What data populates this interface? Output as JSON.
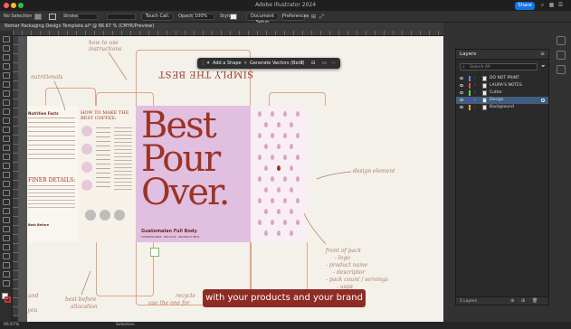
{
  "titlebar": {
    "app_title": "Adobe Illustrator 2024",
    "share_label": "Share"
  },
  "controlbar": {
    "selection_label": "No Selection",
    "stroke_label": "Stroke:",
    "brush_label": "Touch Call.",
    "opacity_label": "Opacity:",
    "opacity_value": "100%",
    "style_label": "Style:",
    "document_setup": "Document Setup",
    "preferences": "Preferences"
  },
  "doc_tab": {
    "label": "Nomer Packaging Design Template.ai* @ 66.67 % (CMYK/Preview)"
  },
  "context_bar": {
    "add_shape": "Add a Shape",
    "generate_vectors": "Generate Vectors (Beta)"
  },
  "artboard": {
    "top_flap_text": "SIMPLY THE BEST",
    "front_title_lines": [
      "Best",
      "Pour",
      "Over."
    ],
    "front_subtitle": "Guatemalan   Full Body",
    "front_tiny": "COMPOSTABLE · RECYCLE · PRODUCT INFO",
    "side_heading": "HOW TO MAKE THE BEST COFFEE:",
    "left_heading": "Nutrition Facts",
    "left_finer": "FINER DETAILS:",
    "left_best_before": "Best Before"
  },
  "annotations": {
    "how_to_use": "how to use\ninstructions",
    "nutritionals": "nutritionals",
    "design_element": "design element",
    "front_of_pack": "front of pack",
    "logo": "- logo",
    "product_name": "- product name",
    "descriptor": "- descriptor",
    "pack_count": "- pack count / servings",
    "usps": "- usps",
    "recycle": "recycle",
    "use_the_one": "use the one for",
    "best_before": "best before",
    "allocation": "allocation",
    "nts_and": "nts and",
    "or_you": "or you"
  },
  "caption": "with your products and your brand",
  "layers_panel": {
    "title": "Layers",
    "search_placeholder": "Search All",
    "layers": [
      {
        "name": "DO NOT PRINT",
        "color": "#4a90e2",
        "selected": false
      },
      {
        "name": "LAURA'S NOTES",
        "color": "#e24a4a",
        "selected": false
      },
      {
        "name": "Cutter",
        "color": "#4ae24a",
        "selected": false
      },
      {
        "name": "Design",
        "color": "#4a4ae2",
        "selected": true
      },
      {
        "name": "Background",
        "color": "#e2a04a",
        "selected": false
      }
    ],
    "footer_count": "5 Layers"
  },
  "status": {
    "zoom": "66.67%",
    "tool": "Selection"
  },
  "colors": {
    "accent": "#1473e6",
    "brand_red": "#9b3425",
    "front_bg": "#e1bfe1",
    "caption_bg": "#8e2b24"
  }
}
